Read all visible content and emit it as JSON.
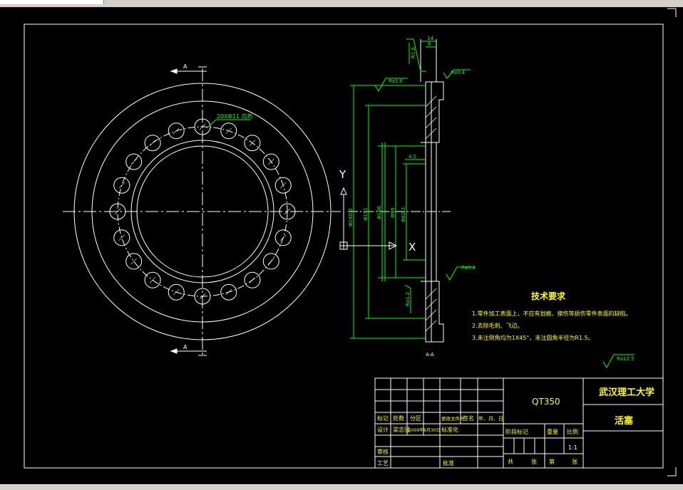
{
  "drawing": {
    "pattern_label": "20XΦ11  均布",
    "section_mark": "A",
    "section_title": "A-A",
    "axis_y": "Y",
    "axis_x": "X",
    "dims_vertical": [
      "Φ160.3",
      "Φ151",
      "Φ136",
      "Φ90",
      "Φ62.3"
    ],
    "dim_top": "14",
    "dim_top_small": "6",
    "dim_r16": "R1.6",
    "dim_45": "4.5",
    "rough_1": "Ra1.6",
    "rough_2": "Ra0.4",
    "rough_3": "Ra0.4",
    "rough_4": "Ra1.2",
    "rough_5": "Ra12.5"
  },
  "tech_req": {
    "title": "技术要求",
    "items": [
      "1.零件加工表面上，不应有划痕、擦伤等损伤零件表面的缺陷。",
      "2.去除毛刺、飞边。",
      "3.未注倒角均为1X45°，未注圆角半径为R1.5。"
    ]
  },
  "title_block": {
    "material": "QT350",
    "school": "武汉理工大学",
    "part_name": "活塞",
    "hdr_mark": "标记",
    "hdr_count": "处数",
    "hdr_zone": "分区",
    "hdr_docno": "更改文件号",
    "hdr_sign": "签名",
    "hdr_date": "年、月、日",
    "design": "设计",
    "designer": "梁志强",
    "design_date": "2009年6月30日",
    "std": "标准化",
    "stage": "阶段标记",
    "weight": "重量",
    "scale_lbl": "比例",
    "scale": "1:1",
    "review": "审核",
    "process": "工艺",
    "approve": "批准",
    "total": "共",
    "sheets": "张",
    "page": "第",
    "sheet": "张"
  }
}
